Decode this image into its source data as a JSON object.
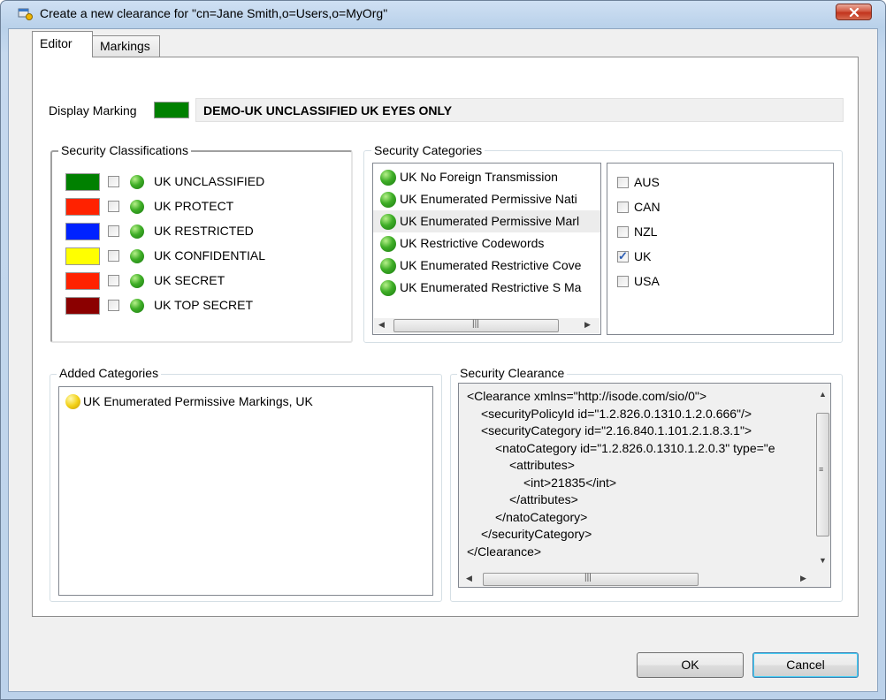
{
  "window": {
    "title": "Create a new clearance for \"cn=Jane Smith,o=Users,o=MyOrg\"",
    "close_label": "x"
  },
  "tabs": [
    {
      "label": "Editor",
      "active": true
    },
    {
      "label": "Markings",
      "active": false
    }
  ],
  "display_marking": {
    "label": "Display Marking",
    "color": "#008000",
    "value": "DEMO-UK UNCLASSIFIED UK EYES ONLY"
  },
  "security_classifications": {
    "title": "Security Classifications",
    "items": [
      {
        "label": "UK UNCLASSIFIED",
        "color": "#008000",
        "checked": false
      },
      {
        "label": "UK PROTECT",
        "color": "#ff2200",
        "checked": false
      },
      {
        "label": "UK RESTRICTED",
        "color": "#0022ff",
        "checked": false
      },
      {
        "label": "UK CONFIDENTIAL",
        "color": "#ffff00",
        "checked": false
      },
      {
        "label": "UK SECRET",
        "color": "#ff2200",
        "checked": false
      },
      {
        "label": "UK TOP SECRET",
        "color": "#8b0000",
        "checked": false
      }
    ]
  },
  "security_categories": {
    "title": "Security Categories",
    "items": [
      {
        "label": "UK No Foreign Transmission"
      },
      {
        "label": "UK Enumerated Permissive Nati"
      },
      {
        "label": "UK Enumerated Permissive Marl"
      },
      {
        "label": "UK Restrictive Codewords"
      },
      {
        "label": "UK Enumerated Restrictive Cove"
      },
      {
        "label": "UK Enumerated Restrictive S Ma"
      }
    ],
    "values": [
      {
        "label": "AUS",
        "checked": false
      },
      {
        "label": "CAN",
        "checked": false
      },
      {
        "label": "NZL",
        "checked": false
      },
      {
        "label": "UK",
        "checked": true
      },
      {
        "label": "USA",
        "checked": false
      }
    ]
  },
  "added_categories": {
    "title": "Added Categories",
    "items": [
      {
        "label": "UK Enumerated Permissive Markings, UK"
      }
    ]
  },
  "security_clearance": {
    "title": "Security Clearance",
    "xml_lines": [
      "<Clearance xmlns=\"http://isode.com/sio/0\">",
      "<securityPolicyId id=\"1.2.826.0.1310.1.2.0.666\"/>",
      "<securityCategory id=\"2.16.840.1.101.2.1.8.3.1\">",
      "<natoCategory id=\"1.2.826.0.1310.1.2.0.3\" type=\"e",
      "<attributes>",
      "<int>21835</int>",
      "</attributes>",
      "</natoCategory>",
      "</securityCategory>",
      "</Clearance>"
    ]
  },
  "buttons": {
    "ok": "OK",
    "cancel": "Cancel"
  }
}
